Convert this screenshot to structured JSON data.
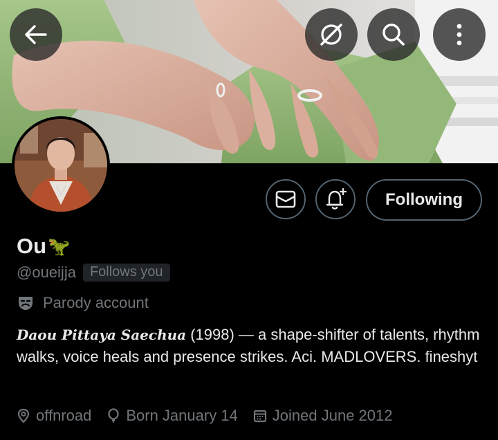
{
  "header": {
    "back_icon": "arrow-left-icon",
    "grok_icon": "grok-icon",
    "search_icon": "search-icon",
    "more_icon": "more-vertical-icon"
  },
  "profile": {
    "name": "Ou",
    "name_emoji": "🦖",
    "handle": "@oueijja",
    "follows_you": "Follows you",
    "parody_label": "Parody account",
    "bio_name": "Daou Pittaya Saechua",
    "bio_text": " (1998) — a shape-shifter of talents, rhythm walks, voice heals and presence strikes. Aci. MADLOVERS. fineshyt",
    "location": "offnroad",
    "birthday": "Born January 14",
    "joined": "Joined June 2012"
  },
  "actions": {
    "message_icon": "envelope-icon",
    "notify_icon": "bell-plus-icon",
    "following_label": "Following"
  },
  "colors": {
    "background": "#000000",
    "text_primary": "#e7e9ea",
    "text_secondary": "#71767b",
    "border": "#536471",
    "badge_bg": "#202327"
  }
}
